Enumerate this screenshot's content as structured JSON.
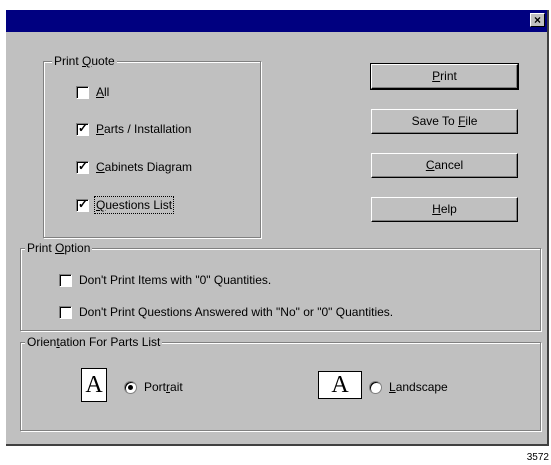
{
  "dialog": {
    "close_glyph": "×"
  },
  "print_quote": {
    "legend_pre": "Print ",
    "legend_acc": "Q",
    "legend_post": "uote",
    "options": [
      {
        "pre": "",
        "acc": "A",
        "post": "ll",
        "checked": false
      },
      {
        "pre": "",
        "acc": "P",
        "post": "arts / Installation",
        "checked": true
      },
      {
        "pre": "",
        "acc": "C",
        "post": "abinets Diagram",
        "checked": true
      },
      {
        "pre": "",
        "acc": "Q",
        "post": "uestions List",
        "checked": true
      }
    ]
  },
  "buttons": {
    "print": {
      "pre": "",
      "acc": "P",
      "post": "rint"
    },
    "save": {
      "pre": "Save To ",
      "acc": "F",
      "post": "ile"
    },
    "cancel": {
      "pre": "",
      "acc": "C",
      "post": "ancel"
    },
    "help": {
      "pre": "",
      "acc": "H",
      "post": "elp"
    }
  },
  "print_option": {
    "legend_pre": "Print ",
    "legend_acc": "O",
    "legend_post": "ption",
    "opt1": "Don't Print Items with \"0\" Quantities.",
    "opt2": "Don't Print Questions Answered with \"No\" or \"0\" Quantities."
  },
  "orientation": {
    "legend_pre": "Orien",
    "legend_acc": "t",
    "legend_post": "ation For Parts List",
    "icon_letter": "A",
    "portrait": {
      "pre": "Port",
      "acc": "r",
      "post": "ait",
      "selected": true
    },
    "landscape": {
      "pre": "",
      "acc": "L",
      "post": "andscape",
      "selected": false
    }
  },
  "footer_number": "3572"
}
